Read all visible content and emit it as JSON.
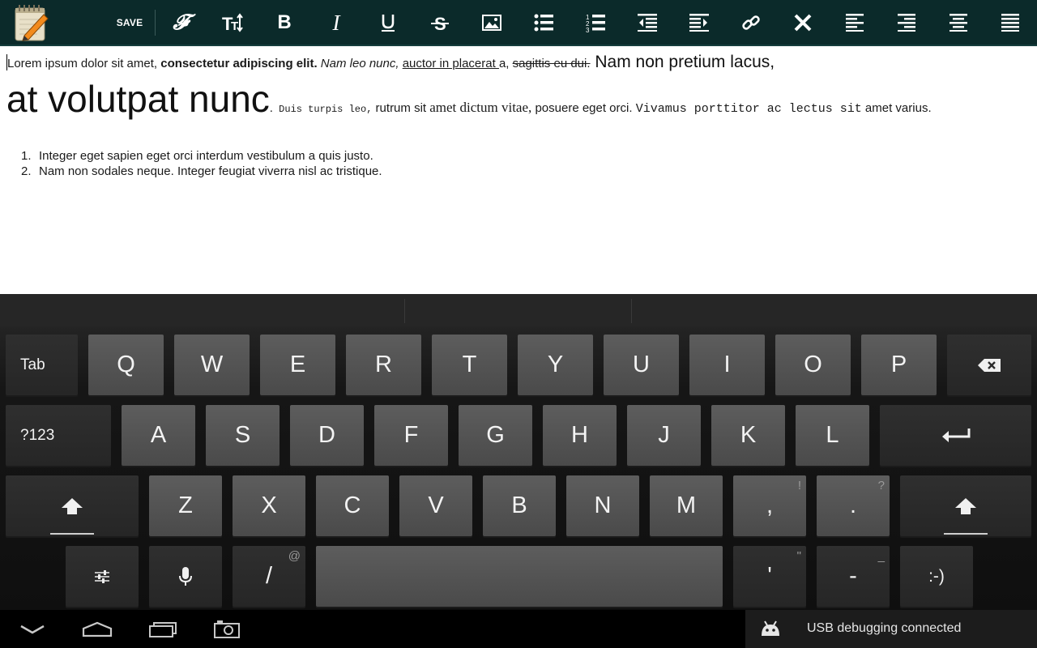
{
  "toolbar": {
    "save_label": "SAVE",
    "buttons": [
      "font-icon",
      "text-size-icon",
      "bold-icon",
      "italic-icon",
      "underline-icon",
      "strikethrough-icon",
      "image-icon",
      "bullet-list-icon",
      "numbered-list-icon",
      "outdent-icon",
      "indent-icon",
      "link-icon",
      "clear-format-icon",
      "align-left-icon",
      "align-right-icon",
      "align-center-icon",
      "justify-icon"
    ]
  },
  "editor": {
    "line1": {
      "plain": "Lorem ipsum dolor sit amet, ",
      "bold": "consectetur adipiscing elit.",
      "italic": " Nam leo nunc,",
      "underline": "auctor in placerat ",
      "after_underline": "a, ",
      "strike": "sagittis eu dui.",
      "medium": " Nam non pretium lacus,"
    },
    "line2": {
      "big": "at volutpat nunc",
      "period": ".",
      "mono_small": " Duis turpis leo,",
      "sans": " rutrum sit ",
      "serif": "amet dictum vitae,",
      "sans2": " posuere eget orci. ",
      "mono": "Vivamus porttitor ac lectus sit",
      "sans3": " amet varius."
    },
    "list": [
      {
        "num": "1.",
        "text": "Integer eget sapien eget orci interdum vestibulum a quis justo."
      },
      {
        "num": "2.",
        "text": "Nam non sodales neque. Integer feugiat viverra nisl ac tristique."
      }
    ]
  },
  "keyboard": {
    "row1": {
      "tab": "Tab",
      "keys": [
        "Q",
        "W",
        "E",
        "R",
        "T",
        "Y",
        "U",
        "I",
        "O",
        "P"
      ]
    },
    "row2": {
      "sym": "?123",
      "keys": [
        "A",
        "S",
        "D",
        "F",
        "G",
        "H",
        "J",
        "K",
        "L"
      ]
    },
    "row3": {
      "keys": [
        "Z",
        "X",
        "C",
        "V",
        "B",
        "N",
        "M"
      ],
      "comma": ",",
      "comma_hint": "!",
      "period": ".",
      "period_hint": "?"
    },
    "row4": {
      "slash": "/",
      "slash_hint": "@",
      "apostrophe": "'",
      "apostrophe_hint": "\"",
      "dash": "-",
      "dash_hint": "_",
      "smiley": ":-)"
    }
  },
  "status": {
    "notification": "USB debugging connected"
  }
}
